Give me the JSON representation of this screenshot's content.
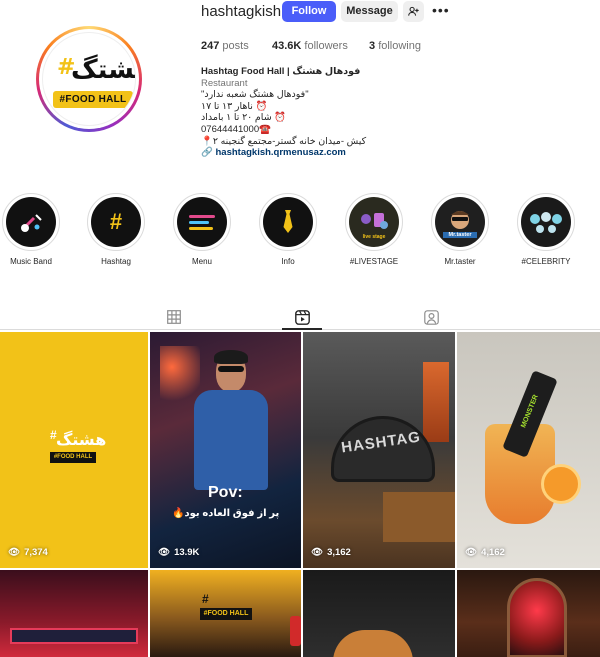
{
  "profile": {
    "username": "hashtagkish",
    "follow_label": "Follow",
    "message_label": "Message",
    "add_user_icon": "add-user-icon",
    "more_icon": "more-icon",
    "logo": {
      "hash": "#",
      "fa_text": "هشتگ",
      "bar_text": "#FOOD HALL"
    }
  },
  "stats": {
    "posts_count": "247",
    "posts_label": "posts",
    "followers_count": "43.6K",
    "followers_label": "followers",
    "following_count": "3",
    "following_label": "following"
  },
  "bio": {
    "name": "Hashtag Food Hall | فودهال هشتگ",
    "category": "Restaurant",
    "lines": [
      "\"فودهال هشتگ شعبه ندارد\"",
      "ناهار ۱۳ تا ۱۷ ⏰",
      "شام ۲۰ تا ۱ بامداد ⏰",
      "07644441000☎️",
      "📍کیش -میدان خانه گستر-مجتمع گنجینه ۲"
    ],
    "link": "hashtagkish.qrmenusaz.com"
  },
  "highlights": [
    {
      "label": "Music Band"
    },
    {
      "label": "Hashtag"
    },
    {
      "label": "Menu"
    },
    {
      "label": "Info"
    },
    {
      "label": "#LIVESTAGE"
    },
    {
      "label": "Mr.taster"
    },
    {
      "label": "#CELEBRITY"
    }
  ],
  "highlight_art": {
    "hashtag": "#",
    "livestage": "live stage",
    "taster": "Mr.taster"
  },
  "tabs": [
    "grid-icon",
    "reels-icon",
    "tagged-icon"
  ],
  "posts": [
    {
      "views": "7,374",
      "overlay_fa": "هشتگ",
      "overlay_bar": "#FOOD HALL",
      "overlay_hash": "#"
    },
    {
      "views": "13.9K",
      "overlay_title": "Pov:",
      "overlay_caption": "🔥پر از فوق العاده بود"
    },
    {
      "views": "3,162",
      "sign_text": "HASHTAG"
    },
    {
      "views": "4,162",
      "can_text": "MONSTER"
    },
    {
      "views": ""
    },
    {
      "views": "",
      "overlay_bar": "#FOOD HALL",
      "overlay_hash": "#"
    },
    {
      "views": ""
    },
    {
      "views": ""
    }
  ],
  "colors": {
    "follow_button": "#4a5df9",
    "brand_yellow": "#f2c218",
    "link": "#00376b"
  }
}
